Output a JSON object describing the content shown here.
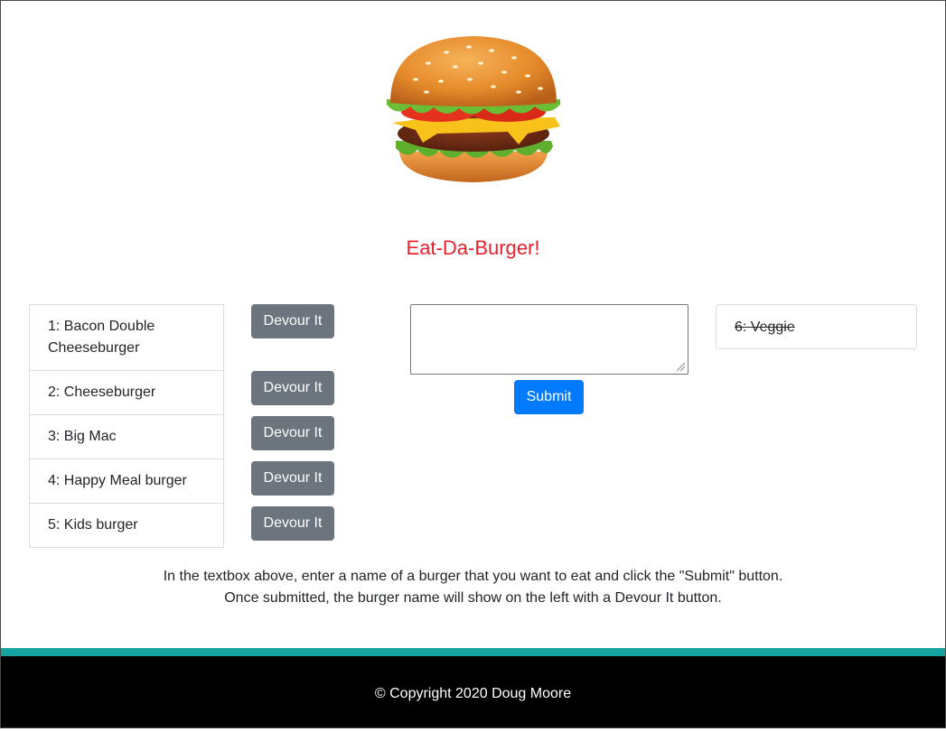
{
  "header": {
    "logo_icon": "hamburger-icon",
    "title": "Eat-Da-Burger!",
    "title_color": "#e8202c"
  },
  "burgers": [
    {
      "label": "1: Bacon Double Cheeseburger",
      "button": "Devour It"
    },
    {
      "label": "2: Cheeseburger",
      "button": "Devour It"
    },
    {
      "label": "3: Big Mac",
      "button": "Devour It"
    },
    {
      "label": "4: Happy Meal burger",
      "button": "Devour It"
    },
    {
      "label": "5: Kids burger",
      "button": "Devour It"
    }
  ],
  "form": {
    "input_value": "",
    "submit_label": "Submit",
    "submit_color": "#007bff"
  },
  "devoured": [
    {
      "label": "6: Veggie"
    }
  ],
  "instructions": {
    "line1": "In the textbox above, enter a name of a burger that you want to eat and click the \"Submit\" button.",
    "line2": "Once submitted, the burger name will show on the left with a Devour It button."
  },
  "footer": {
    "text": "© Copyright 2020 Doug Moore",
    "stripe_color": "#17a2a2"
  }
}
